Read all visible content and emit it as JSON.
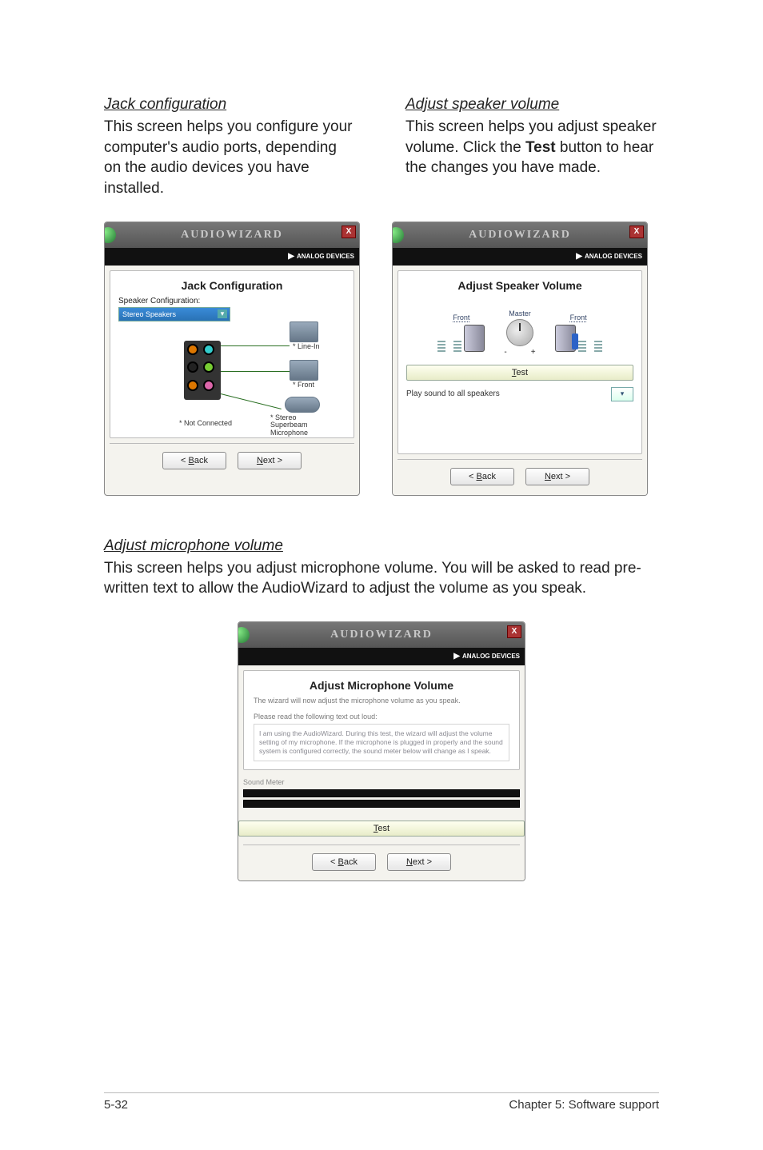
{
  "col_left": {
    "title": "Jack configuration",
    "body": "This screen helps you configure your computer's audio ports, depending on the audio devices you have installed."
  },
  "col_right": {
    "title": "Adjust speaker volume",
    "body_pre": "This screen helps you adjust speaker volume. Click the ",
    "body_bold": "Test",
    "body_post": " button to hear the changes you have made."
  },
  "wizard_common": {
    "title": "AUDIOWIZARD",
    "logo": "ANALOG DEVICES",
    "back": "< Back",
    "next": "Next >",
    "test": "Test"
  },
  "jack_wizard": {
    "heading": "Jack Configuration",
    "label": "Speaker Configuration:",
    "dropdown": "Stereo Speakers",
    "line_in": "* Line-In",
    "front": "* Front",
    "superbeam": "* Stereo Superbeam Microphone",
    "not_connected": "* Not Connected"
  },
  "spk_wizard": {
    "heading": "Adjust Speaker Volume",
    "front": "Front",
    "master": "Master",
    "play": "Play sound to all speakers"
  },
  "section2": {
    "title": "Adjust microphone volume",
    "body": "This screen helps you adjust microphone volume. You will be asked to read pre-written text to allow the AudioWizard to adjust the volume as you speak."
  },
  "mic_wizard": {
    "heading": "Adjust Microphone Volume",
    "desc": "The wizard will now adjust the microphone volume as you speak.",
    "instruction": "Please read the following text out loud:",
    "box": "I am using the AudioWizard. During this test, the wizard will adjust the volume setting of my microphone. If the microphone is plugged in properly and the sound system is configured correctly, the sound meter below will change as I speak.",
    "sound_meter": "Sound Meter"
  },
  "footer": {
    "left": "5-32",
    "right": "Chapter 5: Software support"
  }
}
